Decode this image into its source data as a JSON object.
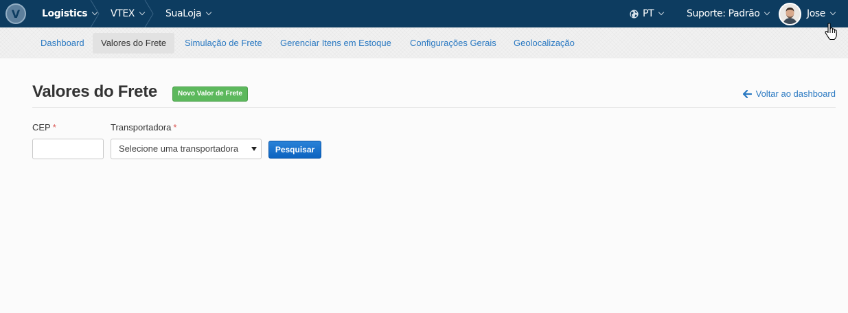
{
  "topbar": {
    "logo_letter": "V",
    "breadcrumbs": [
      {
        "label": "Logistics"
      },
      {
        "label": "VTEX"
      },
      {
        "label": "SuaLoja"
      }
    ],
    "language": "PT",
    "support": "Suporte: Padrão",
    "user": "Jose",
    "colors": {
      "background": "#0d3c60"
    }
  },
  "subnav": {
    "tabs": [
      {
        "label": "Dashboard"
      },
      {
        "label": "Valores do Frete"
      },
      {
        "label": "Simulação de Frete"
      },
      {
        "label": "Gerenciar Itens em Estoque"
      },
      {
        "label": "Configurações Gerais"
      },
      {
        "label": "Geolocalização"
      }
    ],
    "active_tab": "Valores do Frete"
  },
  "page": {
    "title": "Valores do Frete",
    "new_button": "Novo Valor de Frete",
    "back_link": "Voltar ao dashboard"
  },
  "form": {
    "cep_label": "CEP",
    "cep_value": "",
    "carrier_label": "Transportadora",
    "required_mark": "*",
    "carrier_select": "Selecione uma transportadora",
    "search_button": "Pesquisar"
  },
  "icons": {
    "language": "globe-icon",
    "back": "arrow-left-icon",
    "cursor": "hand-pointer-icon"
  }
}
